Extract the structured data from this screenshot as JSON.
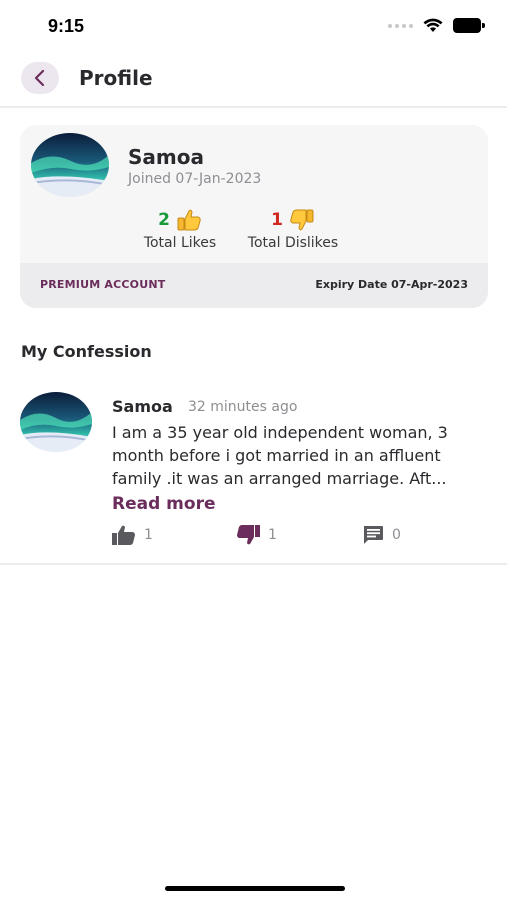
{
  "status_bar": {
    "time": "9:15"
  },
  "header": {
    "title": "Profile",
    "back_icon": "chevron-left-icon"
  },
  "profile": {
    "name": "Samoa",
    "joined": "Joined 07-Jan-2023",
    "likes": {
      "count": "2",
      "label": "Total Likes",
      "icon": "thumbs-up-emoji"
    },
    "dislikes": {
      "count": "1",
      "label": "Total Dislikes",
      "icon": "thumbs-down-emoji"
    },
    "account_type": "PREMIUM ACCOUNT",
    "expiry": "Expiry Date 07-Apr-2023"
  },
  "section": {
    "title": "My Confession"
  },
  "post": {
    "author": "Samoa",
    "time_ago": "32 minutes ago",
    "body": "I am a 35 year old independent woman, 3 month before i got married in an affluent family .it was an arranged marriage. Aft...",
    "read_more": "Read more",
    "likes": "1",
    "dislikes": "1",
    "comments": "0"
  },
  "colors": {
    "accent": "#6b2d5b",
    "likes_green": "#1a9a3a",
    "dislikes_red": "#d0271f"
  }
}
